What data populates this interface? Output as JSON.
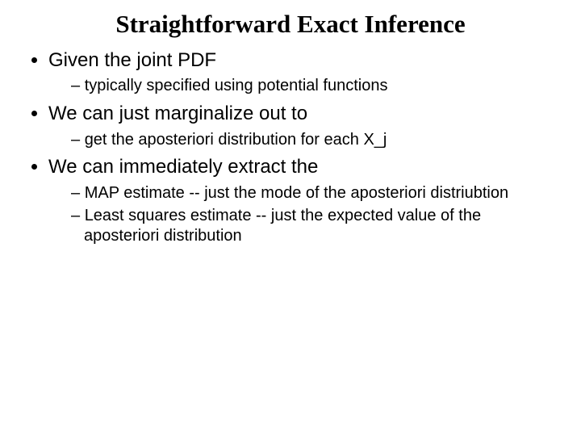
{
  "title": "Straightforward Exact Inference",
  "bullets": [
    {
      "text": "Given the joint PDF",
      "sub": [
        "typically specified using potential functions"
      ]
    },
    {
      "text": "We can just marginalize out to",
      "sub": [
        "get the aposteriori distribution for each X_j"
      ]
    },
    {
      "text": "We can immediately extract the",
      "sub": [
        "MAP estimate -- just the mode of the aposteriori distriubtion",
        "Least squares estimate -- just the expected value of the aposteriori distribution"
      ]
    }
  ]
}
